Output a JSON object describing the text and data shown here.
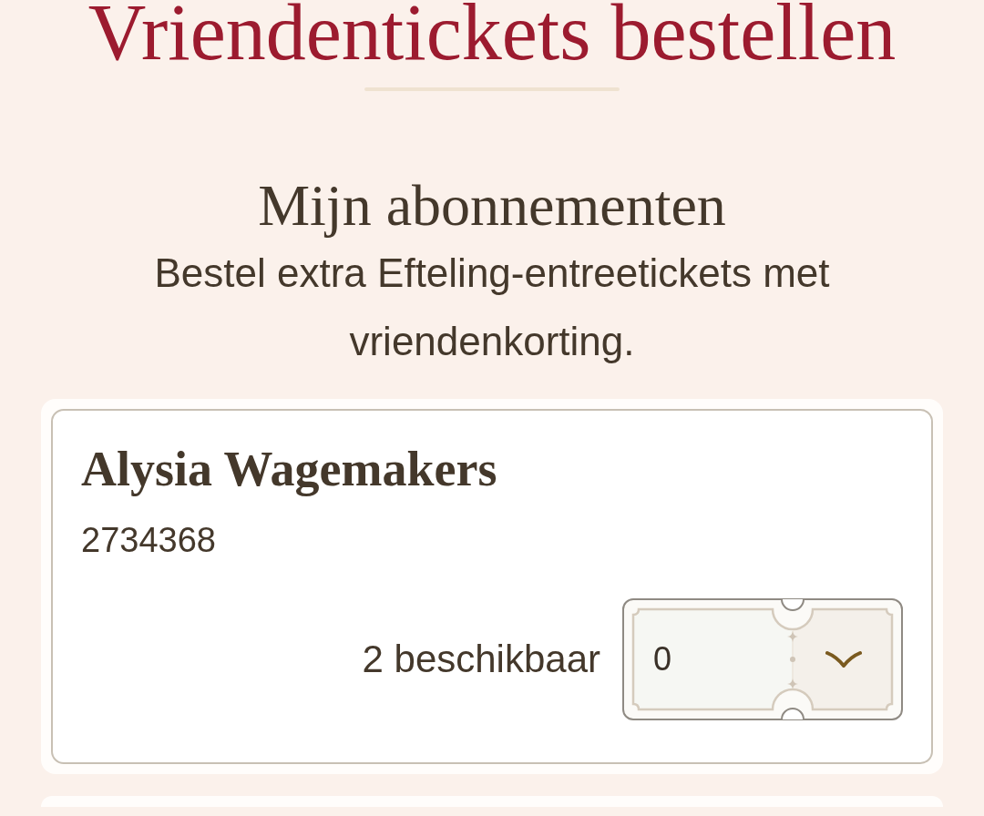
{
  "page": {
    "title": "Vriendentickets bestellen"
  },
  "section": {
    "heading": "Mijn abonnementen",
    "description": "Bestel extra Efteling-entreetickets met vriendenkorting."
  },
  "subscriptions": [
    {
      "name": "Alysia Wagemakers",
      "number": "2734368",
      "available": "2 beschikbaar",
      "quantity": "0"
    }
  ]
}
